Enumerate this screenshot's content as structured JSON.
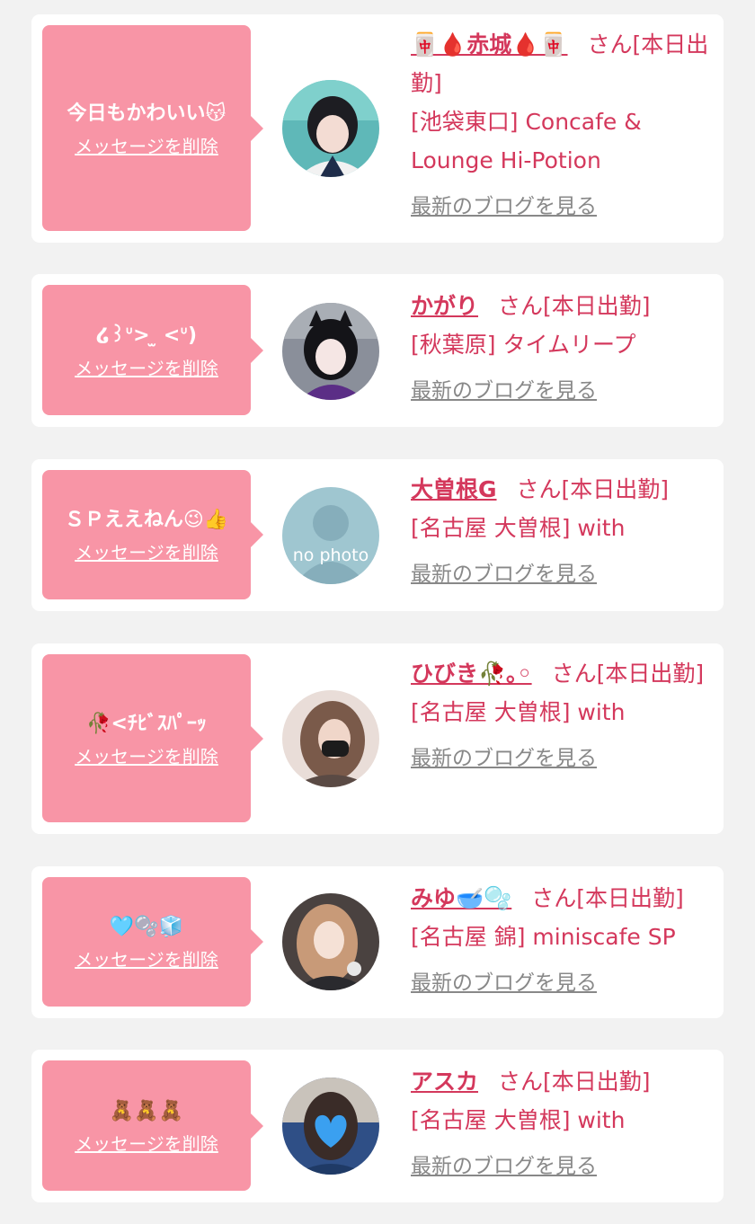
{
  "delete_label": "メッセージを削除",
  "blog_link_label": "最新のブログを見る",
  "colors": {
    "accent": "#d4385c",
    "bubble": "#f895a6",
    "link_gray": "#888888"
  },
  "cards": [
    {
      "message": "今日もかわいい😽",
      "name": "🀄🩸赤城🩸🀄",
      "status": "さん[本日出勤]",
      "shop": "[池袋東口] Concafe & Lounge Hi-Potion",
      "avatar": "profile-photo"
    },
    {
      "message": "໒꒱ᐡ> ̫ <ᐡ)",
      "name": "かがり",
      "status": "さん[本日出勤]",
      "shop": "[秋葉原] タイムリープ",
      "avatar": "profile-photo"
    },
    {
      "message": "ＳＰええねん😉👍",
      "name": "大曽根G",
      "status": "さん[本日出勤]",
      "shop": "[名古屋 大曽根] with",
      "avatar": "no photo"
    },
    {
      "message": "🥀<ﾁﾋﾞｽﾊﾟｰｯ",
      "name": "ひびき🥀｡◦",
      "status": "さん[本日出勤]",
      "shop": "[名古屋 大曽根] with",
      "avatar": "profile-photo"
    },
    {
      "message": "🩵🫧🧊",
      "name": "みゆ🥣🫧",
      "status": "さん[本日出勤]",
      "shop": "[名古屋 錦] miniscafe SP",
      "avatar": "profile-photo"
    },
    {
      "message": "🧸🧸🧸",
      "name": "アスカ",
      "status": "さん[本日出勤]",
      "shop": "[名古屋 大曽根] with",
      "avatar": "profile-photo"
    }
  ]
}
